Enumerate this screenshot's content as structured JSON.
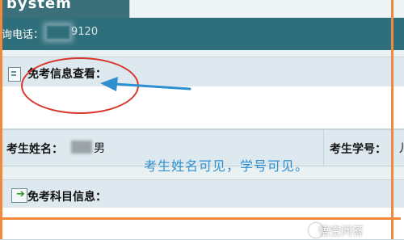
{
  "window": {
    "title_fragment": "bystem"
  },
  "header": {
    "phone_label": "询电话：",
    "phone_partial": "9120"
  },
  "section_exempt_info": {
    "title": "免考信息查看："
  },
  "student_row": {
    "name_label": "考生姓名：",
    "name_visible_suffix": "男",
    "id_label": "考生学号：",
    "id_visible_fragment": "儿"
  },
  "annotation": {
    "text": "考生姓名可见，学号可见。"
  },
  "section_exempt_subjects": {
    "title": "免考科目信息："
  },
  "watermark": {
    "text": "悟空问答"
  },
  "icons": {
    "info_icon": "document-icon",
    "subject_icon": "arrow-right-icon",
    "watermark_icon": "wukong-logo-icon"
  },
  "colors": {
    "teal_header": "#2f6f7b",
    "light_bg": "#dde9ee",
    "annotation_blue": "#2f8fd0",
    "orange_frame": "#f2883a",
    "red_circle": "#d9342b"
  }
}
